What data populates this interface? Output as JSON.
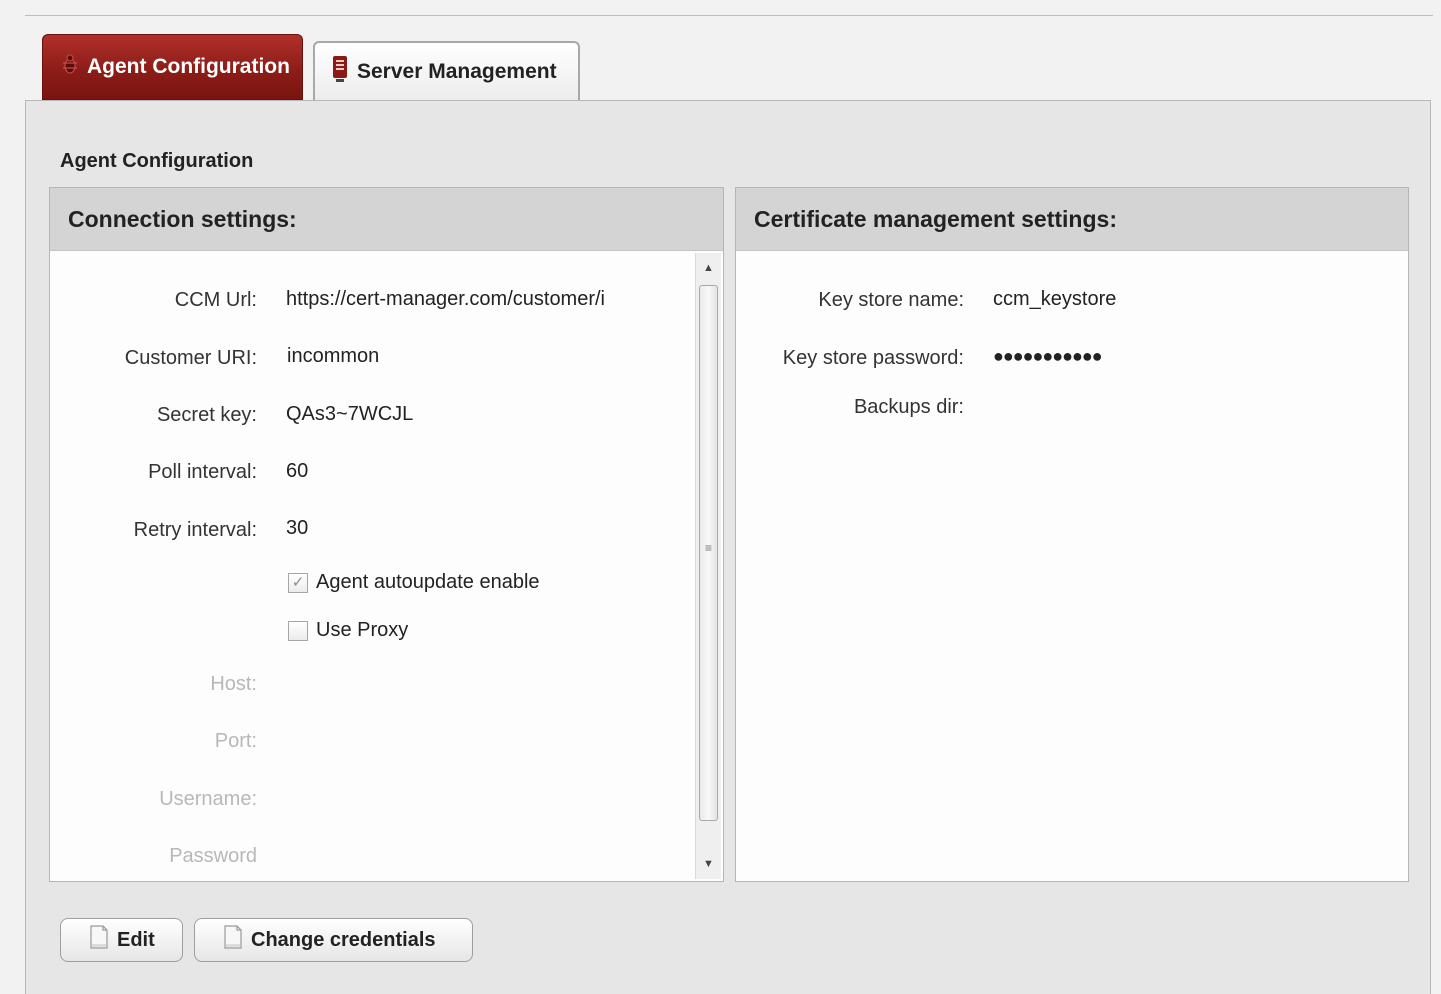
{
  "tabs": [
    {
      "label": "Agent Configuration",
      "icon": "bug-icon",
      "active": true
    },
    {
      "label": "Server Management",
      "icon": "server-icon",
      "active": false
    }
  ],
  "page": {
    "section_title": "Agent Configuration"
  },
  "connection": {
    "header": "Connection settings:",
    "fields": [
      {
        "label": "CCM Url:",
        "value": "https://cert-manager.com/customer/i"
      },
      {
        "label": "Customer URI:",
        "value": "incommon"
      },
      {
        "label": "Secret key:",
        "value": "QAs3~7WCJL"
      },
      {
        "label": "Poll interval:",
        "value": "60"
      },
      {
        "label": "Retry interval:",
        "value": "30"
      }
    ],
    "autoupdate": {
      "label": "Agent autoupdate enable",
      "checked": true
    },
    "use_proxy": {
      "label": "Use Proxy",
      "checked": false
    },
    "proxy_fields": [
      {
        "label": "Host:",
        "value": ""
      },
      {
        "label": "Port:",
        "value": ""
      },
      {
        "label": "Username:",
        "value": ""
      },
      {
        "label": "Password",
        "value": ""
      }
    ]
  },
  "certificate": {
    "header": "Certificate management settings:",
    "fields": [
      {
        "label": "Key store name:",
        "value": "ccm_keystore"
      },
      {
        "label": "Key store password:",
        "value": "●●●●●●●●●●●"
      },
      {
        "label": "Backups dir:",
        "value": ""
      }
    ]
  },
  "buttons": {
    "edit": "Edit",
    "change_credentials": "Change credentials"
  },
  "colors": {
    "accent_tab": "#8c1d18",
    "panel_bg": "#e6e6e6",
    "header_bg": "#d4d4d4"
  }
}
